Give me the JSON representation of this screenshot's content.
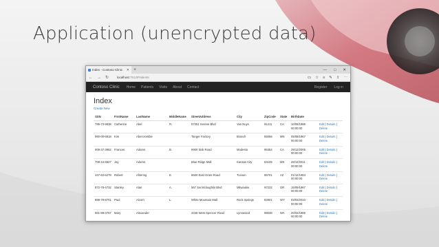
{
  "slide": {
    "title": "Application (unencrypted data)"
  },
  "browser": {
    "tab_title": "Index - Contoso Clinic",
    "new_tab": "+",
    "window_controls": [
      "—",
      "□",
      "✕"
    ],
    "url_host": "localhost",
    "url_rest": ":7512/Patients"
  },
  "navbar": {
    "brand": "Contoso Clinic",
    "links": [
      "Home",
      "Patients",
      "Visits",
      "About",
      "Contact"
    ],
    "right": [
      "Register",
      "Log in"
    ]
  },
  "page": {
    "heading": "Index",
    "create_link": "Create New"
  },
  "table": {
    "headers": [
      "SSN",
      "FirstName",
      "LastName",
      "MiddleName",
      "StreetAddress",
      "City",
      "ZipCode",
      "State",
      "BirthDate",
      ""
    ],
    "rows": [
      [
        "795-73-9838",
        "Catherine",
        "Abel",
        "R.",
        "57251 Serene Blvd",
        "Van Nuys",
        "91411",
        "CA",
        "10/09/1996 00:00:00"
      ],
      [
        "990-00-6818",
        "Kim",
        "Abercrombie",
        "",
        "Tanger Factory",
        "Branch",
        "55056",
        "MN",
        "05/08/1967 00:00:00"
      ],
      [
        "009-37-3952",
        "Frances",
        "Adams",
        "B.",
        "6900 Sisk Road",
        "Modesto",
        "95354",
        "CA",
        "28/12/2005 00:00:00"
      ],
      [
        "708-44-3627",
        "Jay",
        "Adams",
        "",
        "Blue Ridge Mall",
        "Kansas City",
        "64106",
        "MS",
        "28/12/2011 00:00:00"
      ],
      [
        "447-62-6279",
        "Robert",
        "Ahlering",
        "E.",
        "6500 East Grant Road",
        "Tucson",
        "85701",
        "AZ",
        "01/12/1953 00:00:00"
      ],
      [
        "872-78-4732",
        "Stanley",
        "Alan",
        "A.",
        "567 Sw Mcloughlin Blvd",
        "Milwaukie",
        "97222",
        "OR",
        "15/09/1967 00:00:00"
      ],
      [
        "898-79-8701",
        "Paul",
        "Alcorn",
        "L.",
        "White Mountain Mall",
        "Rock Springs",
        "82901",
        "WY",
        "03/03/2010 00:00:00"
      ],
      [
        "561-88-3757",
        "Mary",
        "Alexander",
        "",
        "2345 West Spencer Road",
        "Lynnwood",
        "98036",
        "WA",
        "20/02/1985 00:00:00"
      ]
    ],
    "actions": {
      "edit": "Edit",
      "details": "Details",
      "delete": "Delete",
      "sep": " | "
    }
  }
}
